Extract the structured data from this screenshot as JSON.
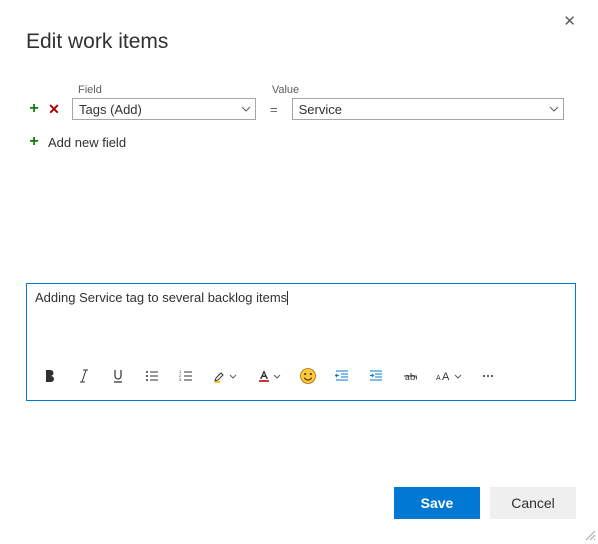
{
  "dialog": {
    "title": "Edit work items"
  },
  "labels": {
    "field": "Field",
    "value": "Value"
  },
  "row": {
    "field_selected": "Tags (Add)",
    "equals": "=",
    "value_selected": "Service"
  },
  "add_new": {
    "label": "Add new field"
  },
  "editor": {
    "text": "Adding Service tag to several backlog items"
  },
  "buttons": {
    "save": "Save",
    "cancel": "Cancel"
  }
}
